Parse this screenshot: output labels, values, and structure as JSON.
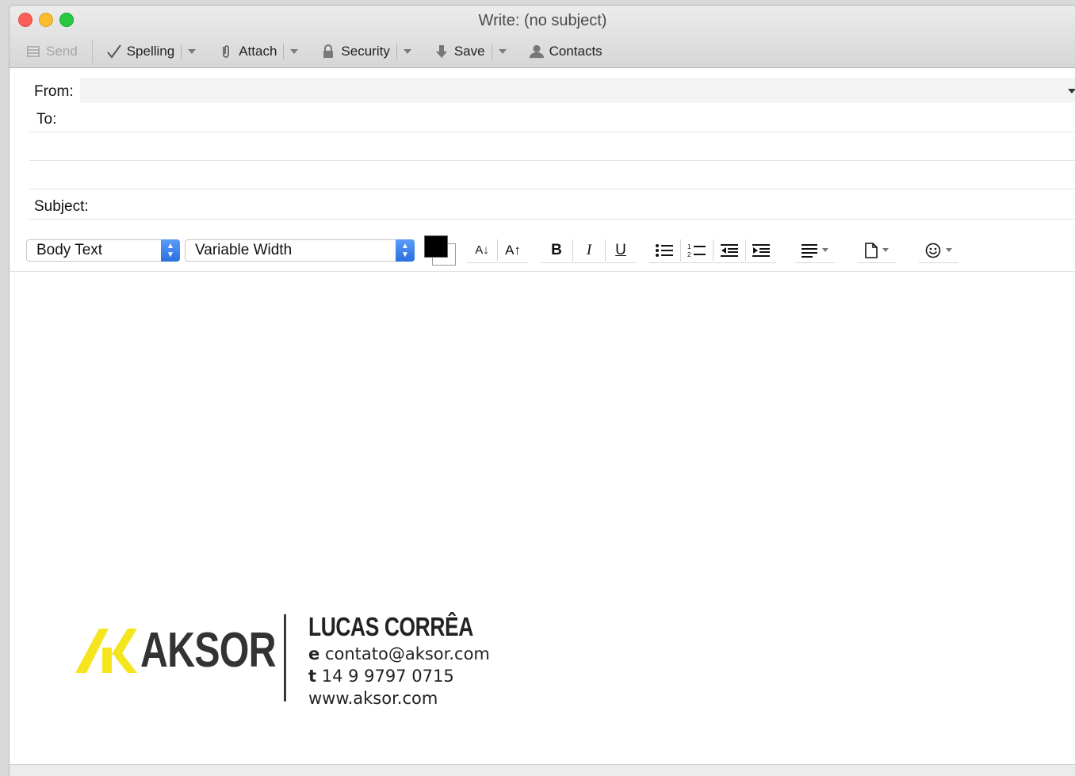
{
  "window": {
    "title": "Write: (no subject)"
  },
  "toolbar": {
    "send_label": "Send",
    "spelling_label": "Spelling",
    "attach_label": "Attach",
    "security_label": "Security",
    "save_label": "Save",
    "contacts_label": "Contacts"
  },
  "header": {
    "from_label": "From:",
    "to_label": "To:",
    "subject_label": "Subject:",
    "from_value": "",
    "to_value": "",
    "subject_value": ""
  },
  "format": {
    "paragraph_style": "Body Text",
    "font": "Variable Width",
    "text_color": "#000000",
    "background_color": "#ffffff",
    "decrease_size": "A↓",
    "increase_size": "A↑",
    "bold": "B",
    "italic": "I",
    "underline": "U"
  },
  "signature": {
    "logo_text": "AKSOR",
    "logo_color": "#f5e51e",
    "name": "LUCAS CORRÊA",
    "email_key": "e",
    "email": "contato@aksor.com",
    "phone_key": "t",
    "phone": "14 9 9797 0715",
    "website": "www.aksor.com"
  },
  "icons": [
    "send-icon",
    "spelling-check-icon",
    "paperclip-icon",
    "lock-icon",
    "save-arrow-icon",
    "contacts-person-icon",
    "bullet-list-icon",
    "numbered-list-icon",
    "outdent-icon",
    "indent-icon",
    "align-left-icon",
    "insert-object-icon",
    "smiley-icon"
  ]
}
